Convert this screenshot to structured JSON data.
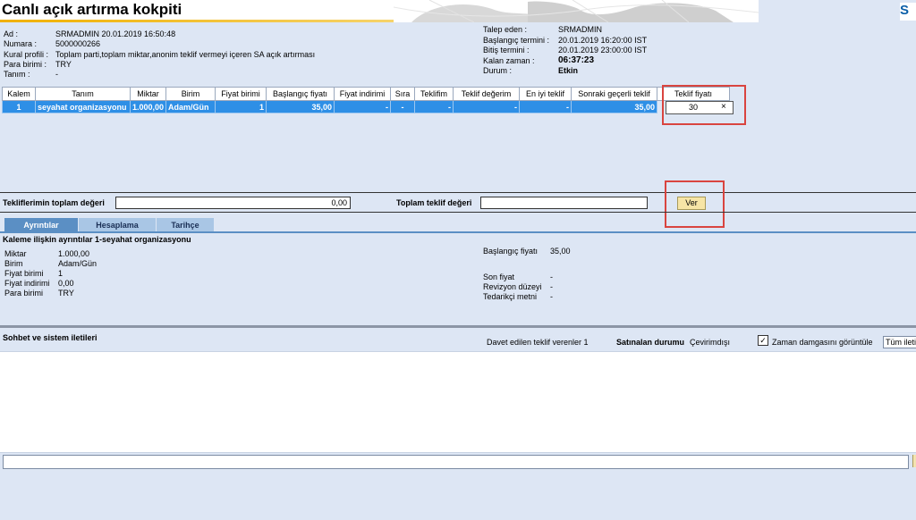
{
  "header": {
    "title": "Canlı açık artırma kokpiti",
    "logo_text": "S"
  },
  "info_left": [
    {
      "label": "Ad :",
      "value": "SRMADMIN 20.01.2019 16:50:48"
    },
    {
      "label": "Numara :",
      "value": "5000000266"
    },
    {
      "label": "Kural profili :",
      "value": "Toplam parti,toplam miktar,anonim teklif vermeyi içeren SA açık artırması"
    },
    {
      "label": "Para birimi :",
      "value": "TRY"
    },
    {
      "label": "Tanım :",
      "value": "-"
    }
  ],
  "info_right": [
    {
      "label": "Talep eden :",
      "value": "SRMADMIN"
    },
    {
      "label": "Başlangıç termini :",
      "value": "20.01.2019 16:20:00 IST"
    },
    {
      "label": "Bitiş termini :",
      "value": "20.01.2019 23:00:00 IST"
    },
    {
      "label": "Kalan zaman :",
      "value": "06:37:23"
    },
    {
      "label": "Durum :",
      "value": "Etkin"
    }
  ],
  "items_table": {
    "columns": [
      "Kalem",
      "Tanım",
      "Miktar",
      "Birim",
      "Fiyat birimi",
      "Başlangıç fiyatı",
      "Fiyat indirimi",
      "Sıra",
      "Teklifim",
      "Teklif değerim",
      "En iyi teklif",
      "Sonraki geçerli teklif",
      "Teklif fiyatı"
    ],
    "rows": [
      [
        "1",
        "seyahat organizasyonu",
        "1.000,00",
        "Adam/Gün",
        "1",
        "35,00",
        "-",
        "-",
        "-",
        "-",
        "-",
        "35,00"
      ]
    ],
    "bid_value": "30",
    "clear_glyph": "×"
  },
  "totals": {
    "my_total_label": "Tekliflerimin toplam değeri",
    "my_total_value": "0,00",
    "total_bid_label": "Toplam teklif değeri",
    "total_bid_value": "",
    "submit_label": "Ver"
  },
  "tabs": [
    {
      "label": "Ayrıntılar",
      "active": true
    },
    {
      "label": "Hesaplama",
      "active": false
    },
    {
      "label": "Tarihçe",
      "active": false
    }
  ],
  "details": {
    "heading": "Kaleme ilişkin ayrıntılar 1-seyahat organizasyonu",
    "left": [
      {
        "label": "Miktar",
        "value": "1.000,00"
      },
      {
        "label": "Birim",
        "value": "Adam/Gün"
      },
      {
        "label": "Fiyat birimi",
        "value": "1"
      },
      {
        "label": "Fiyat indirimi",
        "value": "0,00"
      },
      {
        "label": "Para birimi",
        "value": "TRY"
      }
    ],
    "start_price_label": "Başlangıç fiyatı",
    "start_price_value": "35,00",
    "right": [
      {
        "label": "Son fiyat",
        "value": "-"
      },
      {
        "label": "Revizyon düzeyi",
        "value": "-"
      },
      {
        "label": "Tedarikçi metni",
        "value": "-"
      }
    ]
  },
  "chat": {
    "heading": "Sohbet ve sistem iletileri",
    "invited_label": "Davet edilen teklif verenler 1",
    "buyer_status_label": "Satınalan durumu",
    "buyer_status_value": "Çevirimdışı",
    "timestamp_label": "Zaman damgasını görüntüle",
    "timestamp_checked": true,
    "filter_value": "Tüm ileti"
  },
  "colors": {
    "background": "#dde6f4",
    "row_selected": "#2e8fe6",
    "tab_active": "#5b8fc4",
    "tab_inactive": "#a9c6e5",
    "highlight_box": "#d9443f",
    "submit_button": "#f7e5a6"
  }
}
